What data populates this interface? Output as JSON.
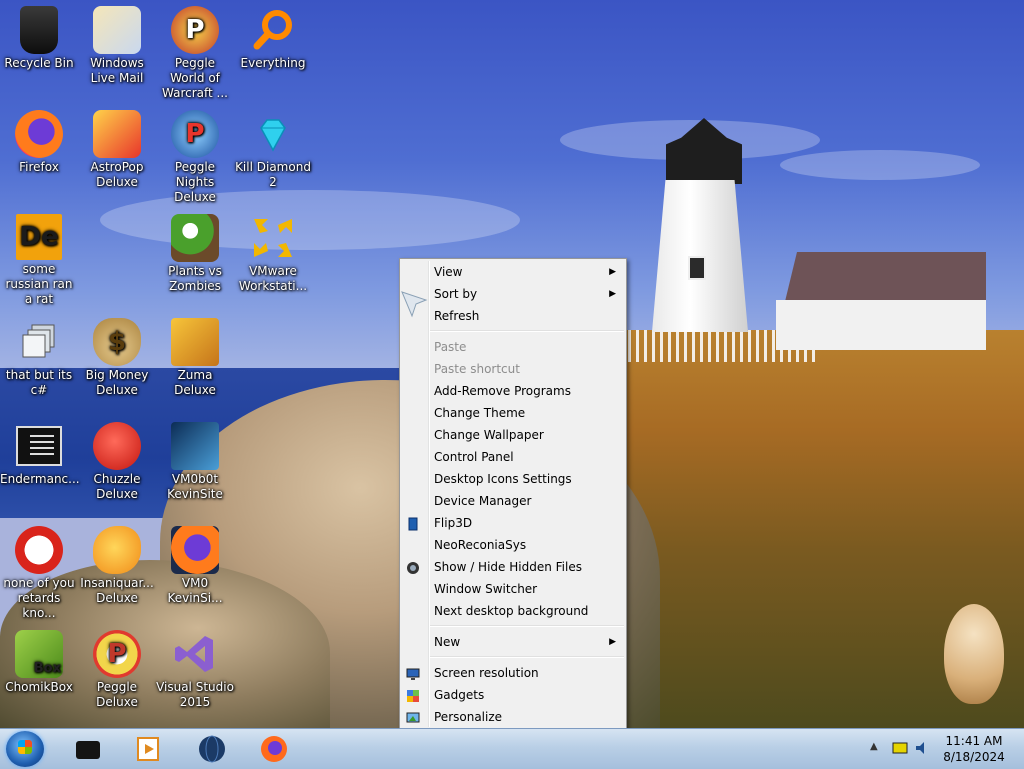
{
  "desktop": {
    "icons": [
      {
        "label": "Recycle Bin"
      },
      {
        "label": "Windows Live Mail"
      },
      {
        "label": "Peggle World of Warcraft ..."
      },
      {
        "label": "Everything"
      },
      {
        "label": "Firefox"
      },
      {
        "label": "AstroPop Deluxe"
      },
      {
        "label": "Peggle Nights Deluxe"
      },
      {
        "label": "Kill Diamond 2"
      },
      {
        "label": "some russian ran a rat"
      },
      {
        "label": "Plants vs Zombies"
      },
      {
        "label": "VMware Workstati..."
      },
      {
        "label": "that but its c#"
      },
      {
        "label": "Big Money Deluxe"
      },
      {
        "label": "Zuma Deluxe"
      },
      {
        "label": "Endermanc..."
      },
      {
        "label": "Chuzzle Deluxe"
      },
      {
        "label": "VM0b0t KevinSite"
      },
      {
        "label": "none of you retards kno..."
      },
      {
        "label": "Insaniquar... Deluxe"
      },
      {
        "label": "VM0 KevinSi..."
      },
      {
        "label": "ChomikBox"
      },
      {
        "label": "Peggle Deluxe"
      },
      {
        "label": "Visual Studio 2015"
      }
    ],
    "glyphs": {
      "de": "De",
      "peggle": "P",
      "money": "$",
      "chomik": "Box"
    }
  },
  "context_menu": {
    "items": [
      {
        "label": "View",
        "submenu": true
      },
      {
        "label": "Sort by",
        "submenu": true
      },
      {
        "label": "Refresh"
      },
      {
        "label": "Paste",
        "disabled": true
      },
      {
        "label": "Paste shortcut",
        "disabled": true
      },
      {
        "label": "Add-Remove Programs"
      },
      {
        "label": "Change Theme"
      },
      {
        "label": "Change Wallpaper"
      },
      {
        "label": "Control Panel"
      },
      {
        "label": "Desktop Icons Settings"
      },
      {
        "label": "Device Manager"
      },
      {
        "label": "Flip3D"
      },
      {
        "label": "NeoReconiaSys"
      },
      {
        "label": "Show / Hide Hidden Files"
      },
      {
        "label": "Window Switcher"
      },
      {
        "label": "Next desktop background"
      },
      {
        "label": "New",
        "submenu": true
      },
      {
        "label": "Screen resolution"
      },
      {
        "label": "Gadgets"
      },
      {
        "label": "Personalize"
      }
    ],
    "arrow_glyph": "▶"
  },
  "taskbar": {
    "tray_arrow": "▲",
    "clock_time": "11:41 AM",
    "clock_date": "8/18/2024"
  },
  "colors": {
    "menu_bg": "#f0f0f0",
    "disabled_text": "#8d8d8d",
    "taskbar_top": "#d6e4f2"
  }
}
